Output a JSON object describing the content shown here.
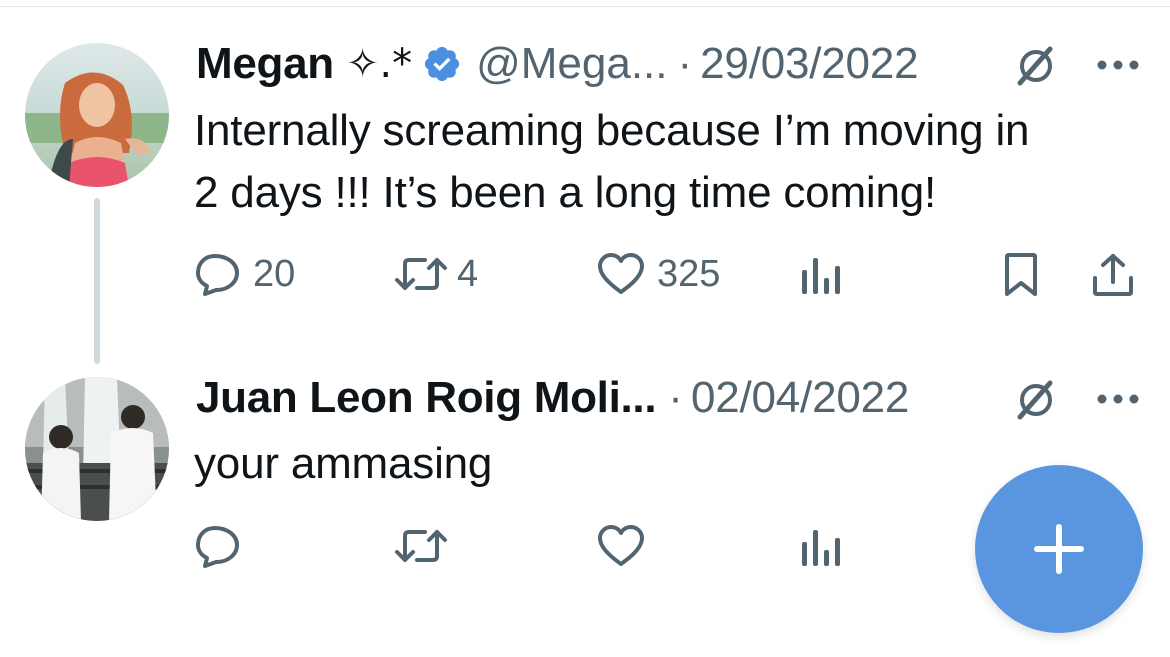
{
  "colors": {
    "text_primary": "#0f1419",
    "text_secondary": "#536471",
    "verified_blue": "#4c8fe0",
    "fab_blue": "#5a95e0",
    "thread_line": "#cfd9de"
  },
  "tweet": {
    "display_name": "Megan",
    "name_decoration": "✧.*",
    "verified": true,
    "handle": "@Mega...",
    "separator": "·",
    "date": "29/03/2022",
    "text": "Internally screaming because I’m moving in\n2 days !!! It’s been a long time coming!",
    "actions": {
      "reply_icon": "reply-icon",
      "reply_count": "20",
      "retweet_icon": "retweet-icon",
      "retweet_count": "4",
      "like_icon": "heart-icon",
      "like_count": "325",
      "views_icon": "analytics-icon",
      "bookmark_icon": "bookmark-icon",
      "share_icon": "share-icon"
    }
  },
  "reply": {
    "display_name": "Juan Leon Roig Moli...",
    "separator": "·",
    "date": "02/04/2022",
    "text": "your ammasing",
    "actions": {
      "reply_icon": "reply-icon",
      "retweet_icon": "retweet-icon",
      "like_icon": "heart-icon",
      "views_icon": "analytics-icon"
    }
  },
  "fab": {
    "icon": "plus-icon"
  }
}
